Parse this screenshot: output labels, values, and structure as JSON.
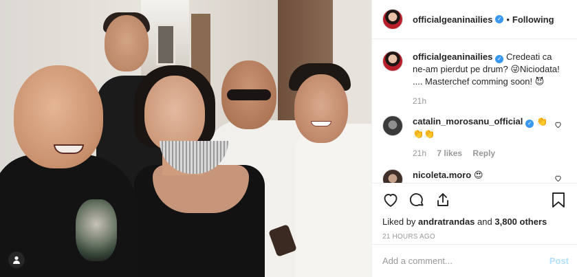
{
  "post": {
    "author": "officialgeaninailies",
    "follow_status": "Following",
    "separator": "•"
  },
  "comments": [
    {
      "username": "officialgeaninailies",
      "text": "Credeati ca ne-am pierdut pe drum? 😜Niciodata! .... Masterchef comming soon! 😈",
      "time": "21h",
      "likes": "",
      "reply": ""
    },
    {
      "username": "catalin_morosanu_official",
      "text": "👏 👏👏",
      "time": "21h",
      "likes": "7 likes",
      "reply": "Reply"
    },
    {
      "username": "nicoleta.moro",
      "text": "😍",
      "time": "",
      "likes": "",
      "reply": ""
    }
  ],
  "engagement": {
    "liked_by_prefix": "Liked by",
    "liked_by_user": "andratrandas",
    "liked_by_and": "and",
    "liked_by_count": "3,800 others",
    "timestamp": "21 HOURS AGO"
  },
  "comment_box": {
    "placeholder": "Add a comment...",
    "post_label": "Post"
  },
  "icons": {
    "like": "heart-icon",
    "comment": "comment-icon",
    "share": "share-icon",
    "save": "bookmark-icon",
    "verified": "verified-badge-icon",
    "tag": "user-tag-icon"
  },
  "colors": {
    "verified_blue": "#3897f0",
    "post_button": "#b2dffc",
    "muted_text": "#999999",
    "border": "#efefef"
  }
}
